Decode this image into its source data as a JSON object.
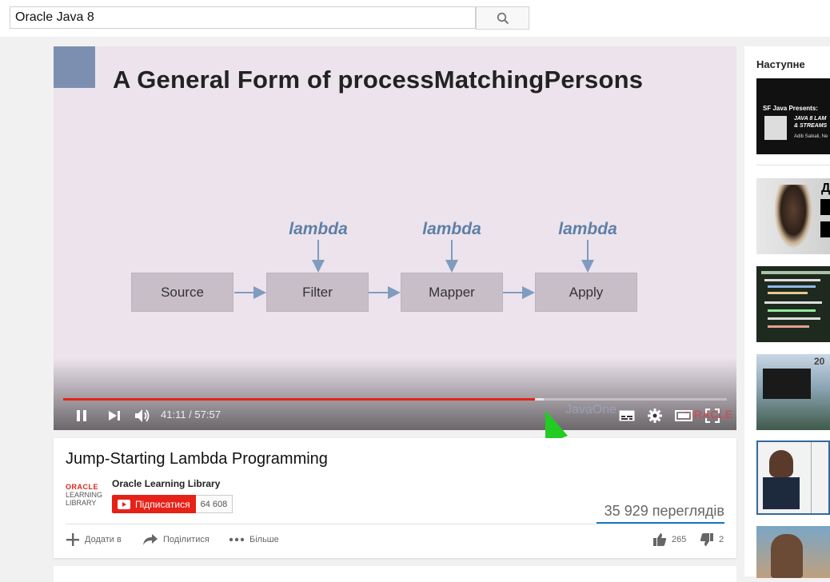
{
  "search": {
    "value": "Oracle Java 8"
  },
  "slide": {
    "title": "A General Form of processMatchingPersons",
    "lambda_labels": [
      "lambda",
      "lambda",
      "lambda"
    ],
    "boxes": [
      "Source",
      "Filter",
      "Mapper",
      "Apply"
    ]
  },
  "player": {
    "time_current": "41:11",
    "time_total": "57:57",
    "time_display": "41:11 / 57:57",
    "progress_fraction": 0.7108,
    "buffered_fraction": 0.724,
    "watermark_java": "JavaOne",
    "watermark_oracle": "ORACLE"
  },
  "video": {
    "title": "Jump-Starting Lambda Programming",
    "channel": "Oracle Learning Library",
    "logo_line1": "ORACLE",
    "logo_line2": "LEARNING",
    "logo_line3": "LIBRARY",
    "subscribe_label": "Підписатися",
    "subscriber_count": "64 608",
    "views": "35 929 переглядів",
    "add_to_label": "Додати в",
    "share_label": "Поділитися",
    "more_label": "Більше",
    "likes": "265",
    "dislikes": "2"
  },
  "sidebar": {
    "next_label": "Наступне",
    "thumb1_line1": "SF Java Presents:",
    "thumb1_line2": "JAVA 8 LAM",
    "thumb1_line3": "& STREAMS",
    "thumb1_line4": "Adib Saikali, Ne",
    "thumb2_text": "Д",
    "thumb4_text": "20"
  },
  "colors": {
    "accent_red": "#e62117",
    "link_blue": "#167ac6",
    "annotation_arrow": "#22cc22"
  }
}
